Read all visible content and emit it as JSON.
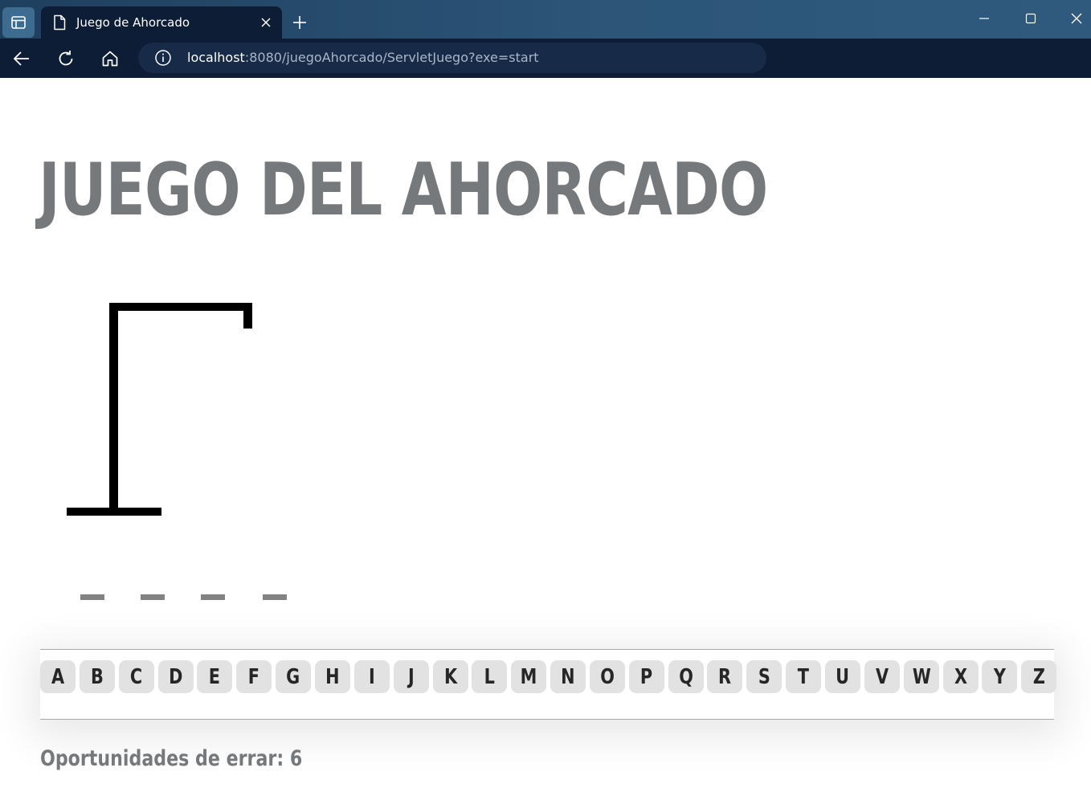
{
  "browser": {
    "tab_title": "Juego de Ahorcado",
    "url_host": "localhost",
    "url_rest": ":8080/juegoAhorcado/ServletJuego?exe=start"
  },
  "icons": {
    "sidebar": "sidebar-icon",
    "tab_page": "page-icon",
    "tab_close": "close-icon",
    "new_tab": "plus-icon",
    "minimize": "minimize-icon",
    "maximize": "maximize-icon",
    "window_close": "close-icon",
    "back": "back-arrow-icon",
    "reload": "reload-icon",
    "home": "home-icon",
    "site_info": "info-icon"
  },
  "game": {
    "title": "JUEGO DEL AHORCADO",
    "word_slots": 4,
    "letters": [
      "A",
      "B",
      "C",
      "D",
      "E",
      "F",
      "G",
      "H",
      "I",
      "J",
      "K",
      "L",
      "M",
      "N",
      "O",
      "P",
      "Q",
      "R",
      "S",
      "T",
      "U",
      "V",
      "W",
      "X",
      "Y",
      "Z"
    ],
    "errors_label": "Oportunidades de errar: 6",
    "colors": {
      "title": "#76797b",
      "gallows": "#000000",
      "slot": "#828282",
      "key_bg": "#e2e2e2"
    }
  }
}
